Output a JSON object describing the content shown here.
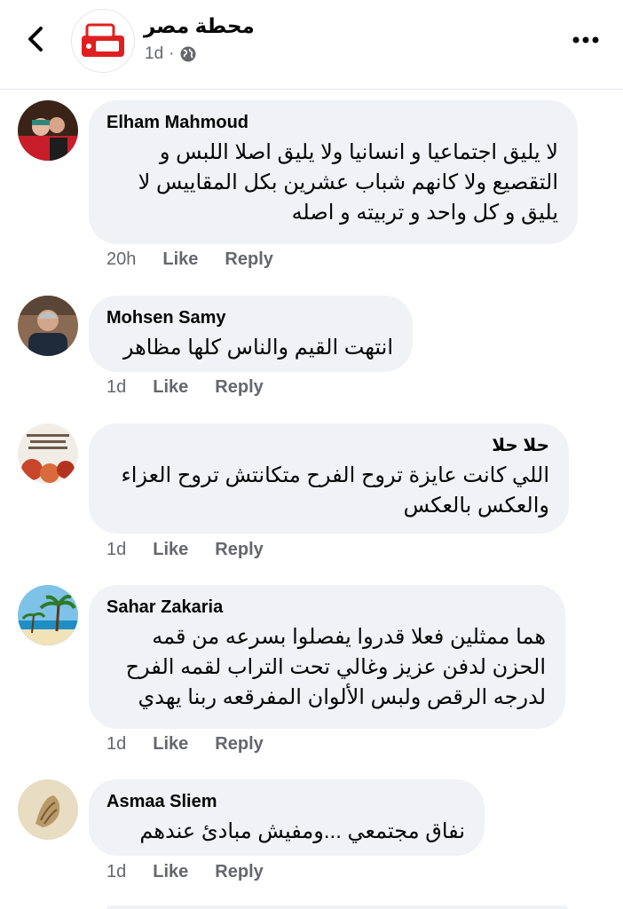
{
  "header": {
    "page_name": "محطة مصر",
    "logo_text_top": "محطة",
    "logo_text_bottom": "مصر",
    "time": "1d",
    "dot": "·",
    "audience_icon": "globe-icon",
    "back_icon": "chevron-left-icon",
    "more_icon": "more-dots-icon"
  },
  "comments": [
    {
      "author": "Elham Mahmoud",
      "text": "لا يليق اجتماعيا و انسانيا ولا يليق اصلا اللبس و التقصيع ولا كانهم شباب عشرين بكل المقاييس لا يليق و كل واحد و تربيته و اصله",
      "time": "20h",
      "like": "Like",
      "reply": "Reply"
    },
    {
      "author": "Mohsen Samy",
      "text": "انتهت القيم والناس كلها مظاهر",
      "time": "1d",
      "like": "Like",
      "reply": "Reply"
    },
    {
      "author": "حلا حلا",
      "text": "اللي كانت عايزة تروح الفرح متكانتش تروح العزاء والعكس بالعكس",
      "time": "1d",
      "like": "Like",
      "reply": "Reply"
    },
    {
      "author": "Sahar Zakaria",
      "text": "هما ممثلين فعلا قدروا يفصلوا بسرعه من قمه الحزن لدفن عزيز وغالي تحت التراب لقمه الفرح لدرجه الرقص ولبس الألوان المفرقعه ربنا يهدي",
      "time": "1d",
      "like": "Like",
      "reply": "Reply"
    },
    {
      "author": "Asmaa Sliem",
      "text": "نفاق مجتمعي ...ومفيش مبادئ عندهم",
      "time": "1d",
      "like": "Like",
      "reply": "Reply"
    }
  ],
  "colors": {
    "bubble": "#f0f2f5",
    "secondary_text": "#65676b",
    "brand_red": "#e02020"
  }
}
